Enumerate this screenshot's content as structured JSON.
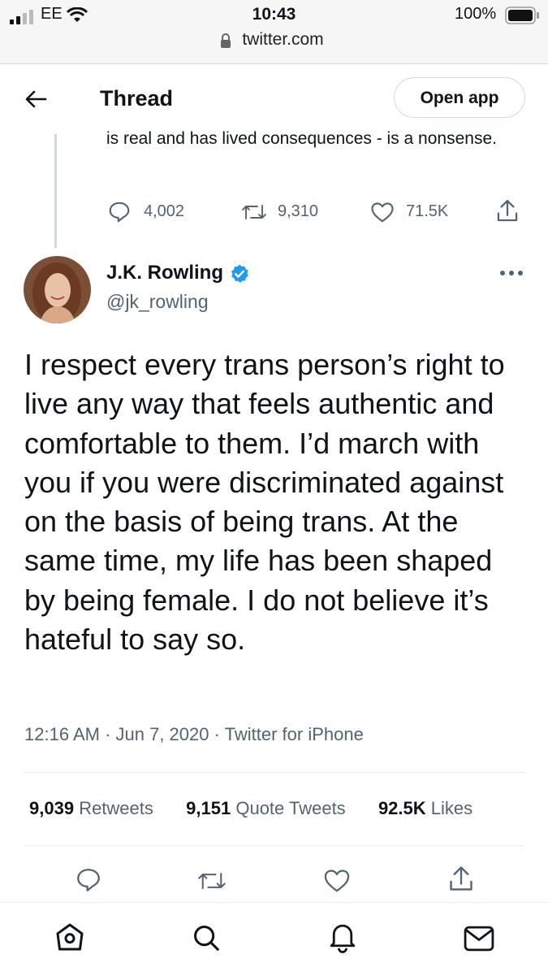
{
  "status_bar": {
    "carrier": "EE",
    "time": "10:43",
    "battery": "100%",
    "url": "twitter.com"
  },
  "header": {
    "title": "Thread",
    "open_app_label": "Open app"
  },
  "previous_tweet": {
    "text": "is real and has lived consequences - is a nonsense.",
    "replies": "4,002",
    "retweets": "9,310",
    "likes": "71.5K"
  },
  "tweet": {
    "author_name": "J.K. Rowling",
    "author_handle": "@jk_rowling",
    "text": "I respect every trans person’s right to live any way that feels authentic and comfortable to them. I’d march with you if you were discriminated against on the basis of being trans. At the same time, my life has been shaped by being female. I do not believe it’s hateful to say so.",
    "timestamp": "12:16 AM · Jun 7, 2020 · Twitter for iPhone",
    "retweets_count": "9,039",
    "retweets_label": "Retweets",
    "quote_count": "9,151",
    "quote_label": "Quote Tweets",
    "likes_count": "92.5K",
    "likes_label": "Likes"
  },
  "colors": {
    "verified": "#1d9bf0",
    "secondary_text": "#536471",
    "primary_text": "#0f1419"
  },
  "tab_bar": [
    "home-icon",
    "search-icon",
    "notifications-icon",
    "messages-icon"
  ]
}
